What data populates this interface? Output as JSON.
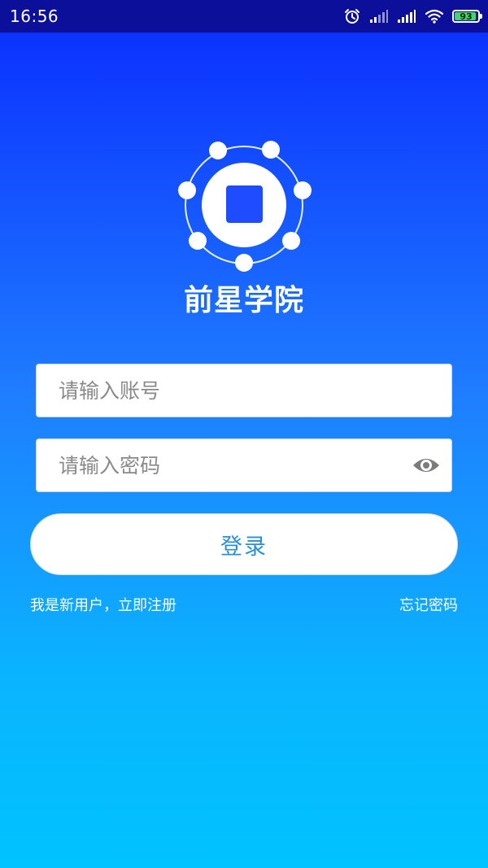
{
  "status_bar": {
    "time": "16:56",
    "battery_level": "93",
    "battery_fraction": 0.93
  },
  "app": {
    "title": "前星学院"
  },
  "login_form": {
    "account_placeholder": "请输入账号",
    "password_placeholder": "请输入密码",
    "login_label": "登录",
    "register_link": "我是新用户，立即注册",
    "forgot_link": "忘记密码"
  },
  "icons": {
    "alarm": "alarm-clock-icon",
    "signal_1": "cellular-signal-icon",
    "signal_2": "cellular-signal-icon",
    "wifi": "wifi-icon",
    "battery": "battery-icon",
    "logo": "app-logo-icon",
    "toggle_password": "eye-icon"
  },
  "colors": {
    "status_bar": "#0c0f9a",
    "gradient_top": "#0a2bff",
    "gradient_bottom": "#00c3ff",
    "button_text": "#2a8fd6",
    "battery_fill": "#46d36b"
  }
}
